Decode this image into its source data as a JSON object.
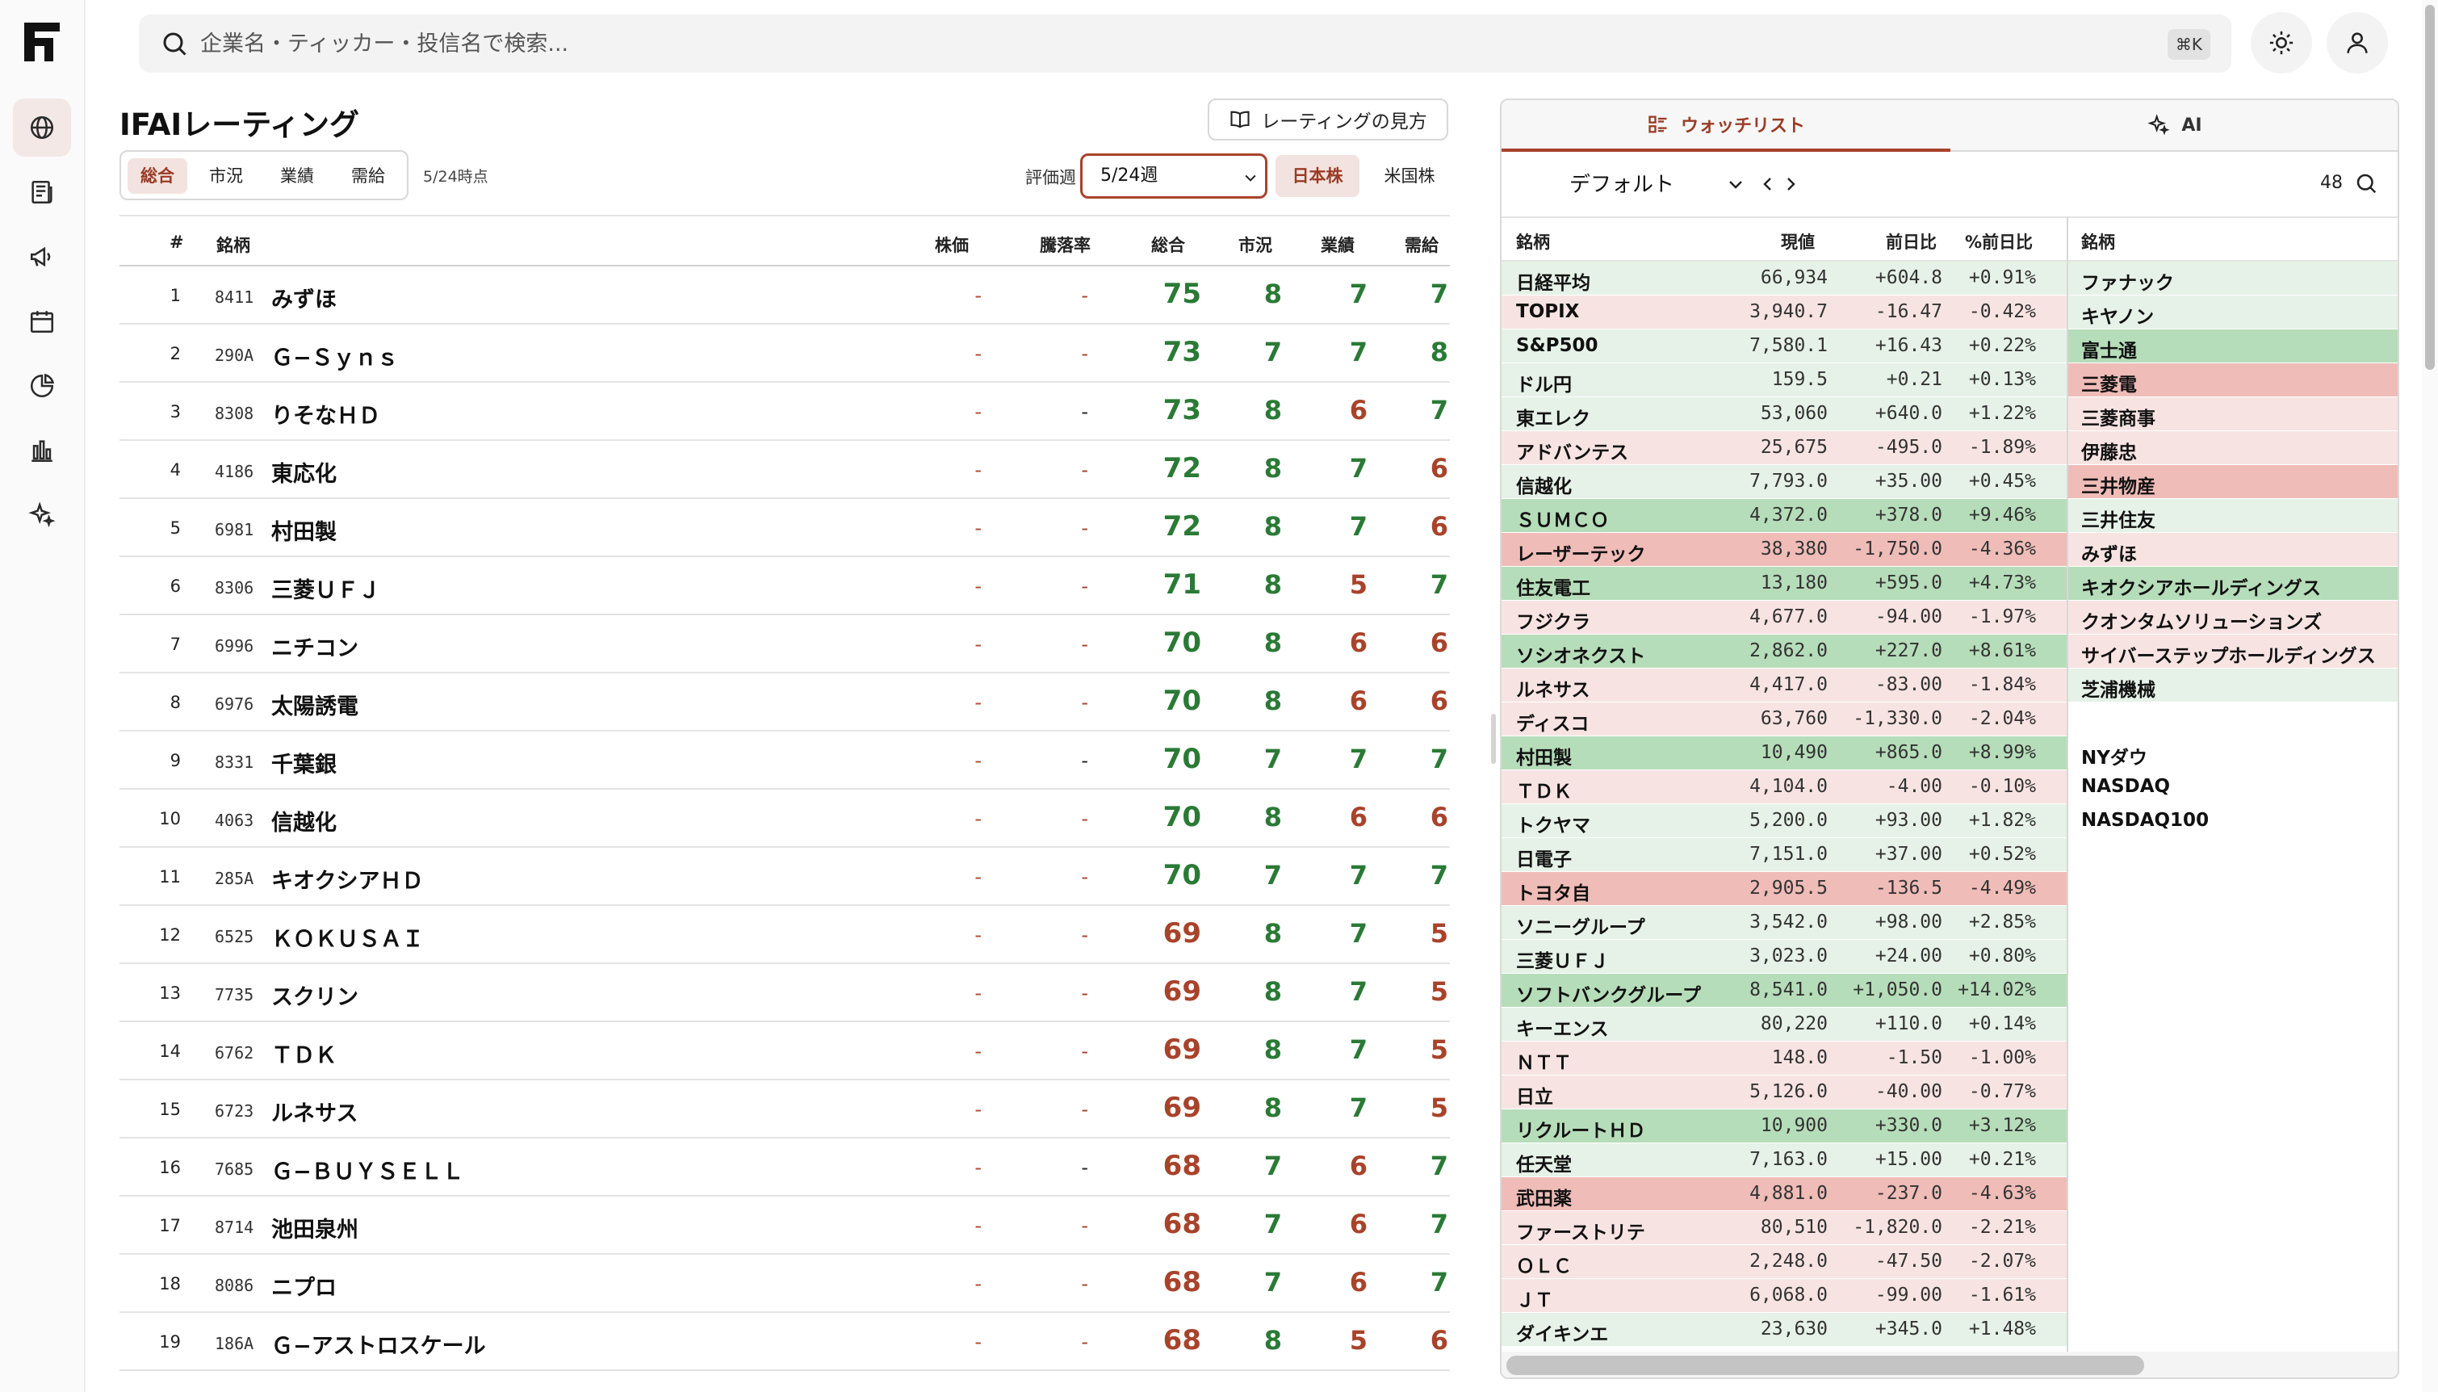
{
  "app": {
    "logo": "F"
  },
  "nav": [
    {
      "icon": "globe-icon",
      "active": true
    },
    {
      "icon": "news-icon",
      "active": false
    },
    {
      "icon": "megaphone-icon",
      "active": false
    },
    {
      "icon": "calendar-icon",
      "active": false
    },
    {
      "icon": "pie-chart-icon",
      "active": false
    },
    {
      "icon": "bar-chart-icon",
      "active": false
    },
    {
      "icon": "sparkle-icon",
      "active": false
    }
  ],
  "search": {
    "placeholder": "企業名・ティッカー・投信名で検索...",
    "shortcut": "⌘K"
  },
  "page": {
    "title": "IFAIレーティング",
    "howto_label": "レーティングの見方",
    "tabs": [
      "総合",
      "市況",
      "業績",
      "需給"
    ],
    "active_tab": 0,
    "as_of": "5/24時点",
    "eval_label": "評価週",
    "week": "5/24週",
    "market_jp": "日本株",
    "market_us": "米国株"
  },
  "ratings": {
    "headers": {
      "rank": "#",
      "name": "銘柄",
      "price": "株価",
      "rate": "騰落率",
      "total": "総合",
      "market": "市況",
      "perf": "業績",
      "supply": "需給"
    },
    "colors": {
      "good": "#2a7a36",
      "bad": "#a8432b",
      "neutral": "#222222"
    },
    "rows": [
      {
        "rank": "1",
        "code": "8411",
        "name": "みずほ",
        "price": "-",
        "rate": "-",
        "total": "75",
        "market": "8",
        "perf": "7",
        "supply": "7",
        "rate_color": "bad",
        "tc": "good",
        "mc": "good",
        "pc": "good",
        "sc": "good"
      },
      {
        "rank": "2",
        "code": "290A",
        "name": "Ｇ−Ｓｙｎｓ",
        "price": "-",
        "rate": "-",
        "total": "73",
        "market": "7",
        "perf": "7",
        "supply": "8",
        "rate_color": "bad",
        "tc": "good",
        "mc": "good",
        "pc": "good",
        "sc": "good"
      },
      {
        "rank": "3",
        "code": "8308",
        "name": "りそなＨＤ",
        "price": "-",
        "rate": "-",
        "total": "73",
        "market": "8",
        "perf": "6",
        "supply": "7",
        "rate_color": "neutral",
        "tc": "good",
        "mc": "good",
        "pc": "bad",
        "sc": "good"
      },
      {
        "rank": "4",
        "code": "4186",
        "name": "東応化",
        "price": "-",
        "rate": "-",
        "total": "72",
        "market": "8",
        "perf": "7",
        "supply": "6",
        "rate_color": "bad",
        "tc": "good",
        "mc": "good",
        "pc": "good",
        "sc": "bad"
      },
      {
        "rank": "5",
        "code": "6981",
        "name": "村田製",
        "price": "-",
        "rate": "-",
        "total": "72",
        "market": "8",
        "perf": "7",
        "supply": "6",
        "rate_color": "bad",
        "tc": "good",
        "mc": "good",
        "pc": "good",
        "sc": "bad"
      },
      {
        "rank": "6",
        "code": "8306",
        "name": "三菱ＵＦＪ",
        "price": "-",
        "rate": "-",
        "total": "71",
        "market": "8",
        "perf": "5",
        "supply": "7",
        "rate_color": "bad",
        "tc": "good",
        "mc": "good",
        "pc": "bad",
        "sc": "good"
      },
      {
        "rank": "7",
        "code": "6996",
        "name": "ニチコン",
        "price": "-",
        "rate": "-",
        "total": "70",
        "market": "8",
        "perf": "6",
        "supply": "6",
        "rate_color": "bad",
        "tc": "good",
        "mc": "good",
        "pc": "bad",
        "sc": "bad"
      },
      {
        "rank": "8",
        "code": "6976",
        "name": "太陽誘電",
        "price": "-",
        "rate": "-",
        "total": "70",
        "market": "8",
        "perf": "6",
        "supply": "6",
        "rate_color": "bad",
        "tc": "good",
        "mc": "good",
        "pc": "bad",
        "sc": "bad"
      },
      {
        "rank": "9",
        "code": "8331",
        "name": "千葉銀",
        "price": "-",
        "rate": "-",
        "total": "70",
        "market": "7",
        "perf": "7",
        "supply": "7",
        "rate_color": "neutral",
        "tc": "good",
        "mc": "good",
        "pc": "good",
        "sc": "good"
      },
      {
        "rank": "10",
        "code": "4063",
        "name": "信越化",
        "price": "-",
        "rate": "-",
        "total": "70",
        "market": "8",
        "perf": "6",
        "supply": "6",
        "rate_color": "bad",
        "tc": "good",
        "mc": "good",
        "pc": "bad",
        "sc": "bad"
      },
      {
        "rank": "11",
        "code": "285A",
        "name": "キオクシアＨＤ",
        "price": "-",
        "rate": "-",
        "total": "70",
        "market": "7",
        "perf": "7",
        "supply": "7",
        "rate_color": "bad",
        "tc": "good",
        "mc": "good",
        "pc": "good",
        "sc": "good"
      },
      {
        "rank": "12",
        "code": "6525",
        "name": "ＫＯＫＵＳＡＩ",
        "price": "-",
        "rate": "-",
        "total": "69",
        "market": "8",
        "perf": "7",
        "supply": "5",
        "rate_color": "bad",
        "tc": "bad",
        "mc": "good",
        "pc": "good",
        "sc": "bad"
      },
      {
        "rank": "13",
        "code": "7735",
        "name": "スクリン",
        "price": "-",
        "rate": "-",
        "total": "69",
        "market": "8",
        "perf": "7",
        "supply": "5",
        "rate_color": "bad",
        "tc": "bad",
        "mc": "good",
        "pc": "good",
        "sc": "bad"
      },
      {
        "rank": "14",
        "code": "6762",
        "name": "ＴＤＫ",
        "price": "-",
        "rate": "-",
        "total": "69",
        "market": "8",
        "perf": "7",
        "supply": "5",
        "rate_color": "bad",
        "tc": "bad",
        "mc": "good",
        "pc": "good",
        "sc": "bad"
      },
      {
        "rank": "15",
        "code": "6723",
        "name": "ルネサス",
        "price": "-",
        "rate": "-",
        "total": "69",
        "market": "8",
        "perf": "7",
        "supply": "5",
        "rate_color": "bad",
        "tc": "bad",
        "mc": "good",
        "pc": "good",
        "sc": "bad"
      },
      {
        "rank": "16",
        "code": "7685",
        "name": "Ｇ−ＢＵＹＳＥＬＬ",
        "price": "-",
        "rate": "-",
        "total": "68",
        "market": "7",
        "perf": "6",
        "supply": "7",
        "rate_color": "neutral",
        "tc": "bad",
        "mc": "good",
        "pc": "bad",
        "sc": "good"
      },
      {
        "rank": "17",
        "code": "8714",
        "name": "池田泉州",
        "price": "-",
        "rate": "-",
        "total": "68",
        "market": "7",
        "perf": "6",
        "supply": "7",
        "rate_color": "bad",
        "tc": "bad",
        "mc": "good",
        "pc": "bad",
        "sc": "good"
      },
      {
        "rank": "18",
        "code": "8086",
        "name": "ニプロ",
        "price": "-",
        "rate": "-",
        "total": "68",
        "market": "7",
        "perf": "6",
        "supply": "7",
        "rate_color": "bad",
        "tc": "bad",
        "mc": "good",
        "pc": "bad",
        "sc": "good"
      },
      {
        "rank": "19",
        "code": "186A",
        "name": "Ｇ−アストロスケール",
        "price": "-",
        "rate": "-",
        "total": "68",
        "market": "8",
        "perf": "5",
        "supply": "6",
        "rate_color": "bad",
        "tc": "bad",
        "mc": "good",
        "pc": "bad",
        "sc": "bad"
      }
    ]
  },
  "watchlist": {
    "tab_watch": "ウォッチリスト",
    "tab_ai": "AI",
    "list_name": "デフォルト",
    "count": "48",
    "headers": {
      "name": "銘柄",
      "price": "現値",
      "chg": "前日比",
      "pct": "%前日比",
      "name2": "銘柄"
    },
    "bg": {
      "up": "#e6f2e7",
      "up_strong": "#b6ddb9",
      "down": "#f7e4e2",
      "down_strong": "#efbcb8",
      "none": "#ffffff"
    },
    "rows": [
      {
        "name": "日経平均",
        "price": "66,934",
        "chg": "+604.8",
        "pct": "+0.91%",
        "bg": "up"
      },
      {
        "name": "TOPIX",
        "price": "3,940.7",
        "chg": "-16.47",
        "pct": "-0.42%",
        "bg": "down"
      },
      {
        "name": "S&P500",
        "price": "7,580.1",
        "chg": "+16.43",
        "pct": "+0.22%",
        "bg": "up"
      },
      {
        "name": "ドル円",
        "price": "159.5",
        "chg": "+0.21",
        "pct": "+0.13%",
        "bg": "up"
      },
      {
        "name": "東エレク",
        "price": "53,060",
        "chg": "+640.0",
        "pct": "+1.22%",
        "bg": "up"
      },
      {
        "name": "アドバンテス",
        "price": "25,675",
        "chg": "-495.0",
        "pct": "-1.89%",
        "bg": "down"
      },
      {
        "name": "信越化",
        "price": "7,793.0",
        "chg": "+35.00",
        "pct": "+0.45%",
        "bg": "up"
      },
      {
        "name": "ＳＵＭＣＯ",
        "price": "4,372.0",
        "chg": "+378.0",
        "pct": "+9.46%",
        "bg": "up_strong"
      },
      {
        "name": "レーザーテック",
        "price": "38,380",
        "chg": "-1,750.0",
        "pct": "-4.36%",
        "bg": "down_strong"
      },
      {
        "name": "住友電工",
        "price": "13,180",
        "chg": "+595.0",
        "pct": "+4.73%",
        "bg": "up_strong"
      },
      {
        "name": "フジクラ",
        "price": "4,677.0",
        "chg": "-94.00",
        "pct": "-1.97%",
        "bg": "down"
      },
      {
        "name": "ソシオネクスト",
        "price": "2,862.0",
        "chg": "+227.0",
        "pct": "+8.61%",
        "bg": "up_strong"
      },
      {
        "name": "ルネサス",
        "price": "4,417.0",
        "chg": "-83.00",
        "pct": "-1.84%",
        "bg": "down"
      },
      {
        "name": "ディスコ",
        "price": "63,760",
        "chg": "-1,330.0",
        "pct": "-2.04%",
        "bg": "down"
      },
      {
        "name": "村田製",
        "price": "10,490",
        "chg": "+865.0",
        "pct": "+8.99%",
        "bg": "up_strong"
      },
      {
        "name": "ＴＤＫ",
        "price": "4,104.0",
        "chg": "-4.00",
        "pct": "-0.10%",
        "bg": "down"
      },
      {
        "name": "トクヤマ",
        "price": "5,200.0",
        "chg": "+93.00",
        "pct": "+1.82%",
        "bg": "up"
      },
      {
        "name": "日電子",
        "price": "7,151.0",
        "chg": "+37.00",
        "pct": "+0.52%",
        "bg": "up"
      },
      {
        "name": "トヨタ自",
        "price": "2,905.5",
        "chg": "-136.5",
        "pct": "-4.49%",
        "bg": "down_strong"
      },
      {
        "name": "ソニーグループ",
        "price": "3,542.0",
        "chg": "+98.00",
        "pct": "+2.85%",
        "bg": "up"
      },
      {
        "name": "三菱ＵＦＪ",
        "price": "3,023.0",
        "chg": "+24.00",
        "pct": "+0.80%",
        "bg": "up"
      },
      {
        "name": "ソフトバンクグループ",
        "price": "8,541.0",
        "chg": "+1,050.0",
        "pct": "+14.02%",
        "bg": "up_strong"
      },
      {
        "name": "キーエンス",
        "price": "80,220",
        "chg": "+110.0",
        "pct": "+0.14%",
        "bg": "up"
      },
      {
        "name": "ＮＴＴ",
        "price": "148.0",
        "chg": "-1.50",
        "pct": "-1.00%",
        "bg": "down"
      },
      {
        "name": "日立",
        "price": "5,126.0",
        "chg": "-40.00",
        "pct": "-0.77%",
        "bg": "down"
      },
      {
        "name": "リクルートＨＤ",
        "price": "10,900",
        "chg": "+330.0",
        "pct": "+3.12%",
        "bg": "up_strong"
      },
      {
        "name": "任天堂",
        "price": "7,163.0",
        "chg": "+15.00",
        "pct": "+0.21%",
        "bg": "up"
      },
      {
        "name": "武田薬",
        "price": "4,881.0",
        "chg": "-237.0",
        "pct": "-4.63%",
        "bg": "down_strong"
      },
      {
        "name": "ファーストリテ",
        "price": "80,510",
        "chg": "-1,820.0",
        "pct": "-2.21%",
        "bg": "down"
      },
      {
        "name": "ＯＬＣ",
        "price": "2,248.0",
        "chg": "-47.50",
        "pct": "-2.07%",
        "bg": "down"
      },
      {
        "name": "ＪＴ",
        "price": "6,068.0",
        "chg": "-99.00",
        "pct": "-1.61%",
        "bg": "down"
      },
      {
        "name": "ダイキンエ",
        "price": "23,630",
        "chg": "+345.0",
        "pct": "+1.48%",
        "bg": "up"
      }
    ],
    "rows2": [
      {
        "name": "ファナック",
        "bg": "up"
      },
      {
        "name": "キヤノン",
        "bg": "up"
      },
      {
        "name": "富士通",
        "bg": "up_strong"
      },
      {
        "name": "三菱電",
        "bg": "down_strong"
      },
      {
        "name": "三菱商事",
        "bg": "down"
      },
      {
        "name": "伊藤忠",
        "bg": "down"
      },
      {
        "name": "三井物産",
        "bg": "down_strong"
      },
      {
        "name": "三井住友",
        "bg": "up"
      },
      {
        "name": "みずほ",
        "bg": "down"
      },
      {
        "name": "キオクシアホールディングス",
        "bg": "up_strong"
      },
      {
        "name": "クオンタムソリューションズ",
        "bg": "down"
      },
      {
        "name": "サイバーステップホールディングス",
        "bg": "down"
      },
      {
        "name": "芝浦機械",
        "bg": "up"
      },
      {
        "name": "",
        "bg": "none"
      },
      {
        "name": "NYダウ",
        "bg": "none"
      },
      {
        "name": "NASDAQ",
        "bg": "none"
      },
      {
        "name": "NASDAQ100",
        "bg": "none"
      }
    ]
  }
}
